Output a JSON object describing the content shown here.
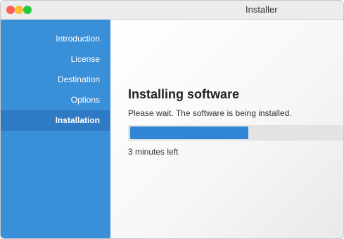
{
  "window": {
    "title": "Installer"
  },
  "sidebar": {
    "items": [
      {
        "label": "Introduction"
      },
      {
        "label": "License"
      },
      {
        "label": "Destination"
      },
      {
        "label": "Options"
      },
      {
        "label": "Installation"
      }
    ],
    "active_index": 4
  },
  "main": {
    "heading": "Installing software",
    "message": "Please wait. The software is being installed.",
    "progress": 0.55,
    "time_left": "3 minutes left"
  },
  "colors": {
    "sidebar": "#3a8fd9",
    "sidebar_active": "#2f7ac4",
    "progress_fill": "#2e86d4"
  }
}
